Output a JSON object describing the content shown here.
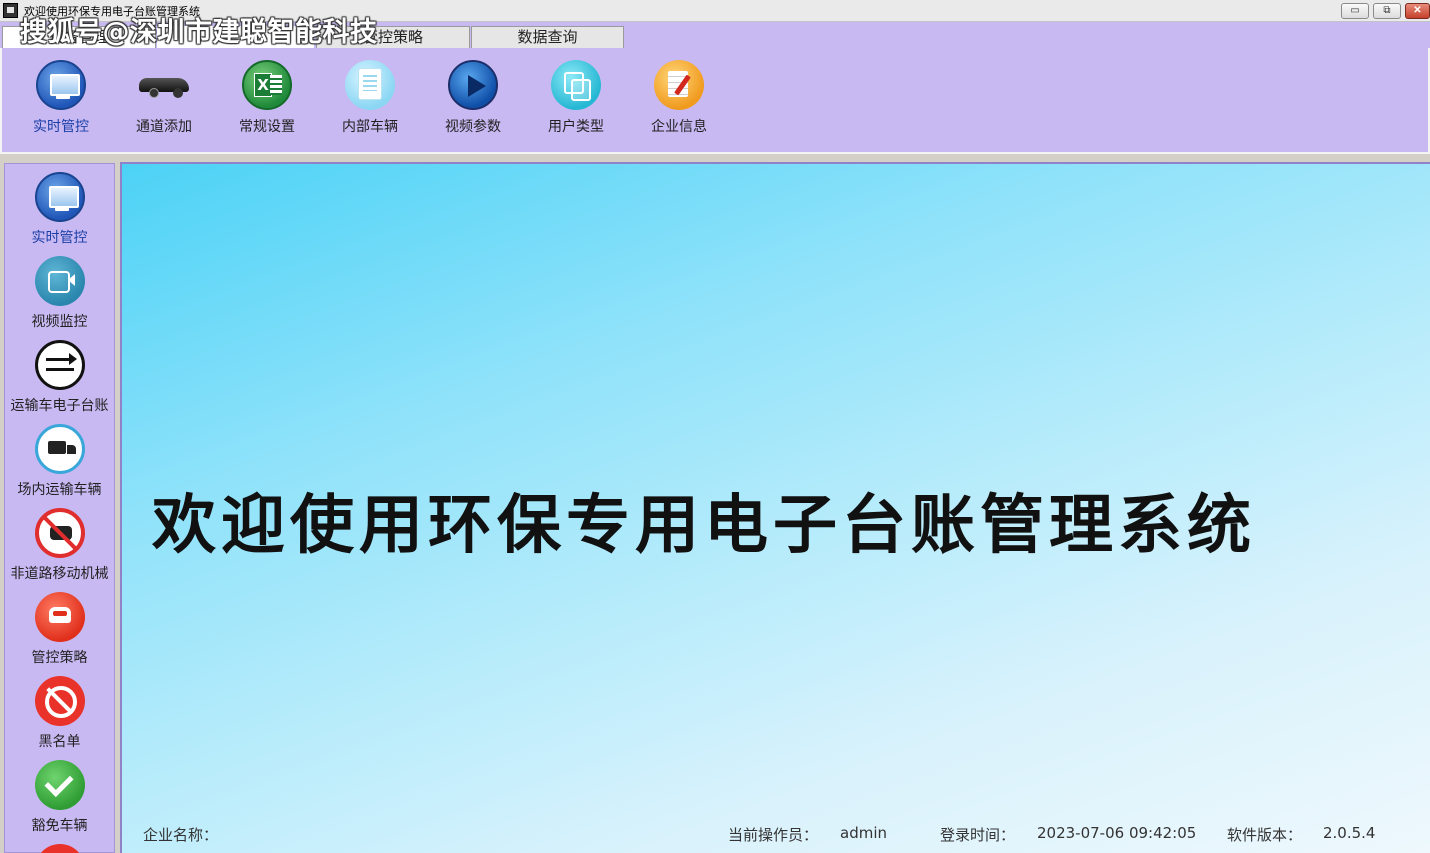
{
  "window": {
    "title": "欢迎使用环保专用电子台账管理系统",
    "watermark": "搜狐号@深圳市建聪智能科技",
    "controls": {
      "minimize": "▭",
      "maximize": "⧉",
      "close": "✕"
    }
  },
  "tabs": [
    {
      "label": "设备管理",
      "icon": ""
    },
    {
      "label": "",
      "icon": ""
    },
    {
      "label": "管控策略",
      "icon": ""
    },
    {
      "label": "数据查询",
      "icon": ""
    }
  ],
  "toolbar": {
    "items": [
      {
        "label": "实时管控",
        "icon": "monitor-icon"
      },
      {
        "label": "通道添加",
        "icon": "car-icon"
      },
      {
        "label": "常规设置",
        "icon": "excel-icon"
      },
      {
        "label": "内部车辆",
        "icon": "document-icon"
      },
      {
        "label": "视频参数",
        "icon": "play-icon"
      },
      {
        "label": "用户类型",
        "icon": "copy-icon"
      },
      {
        "label": "企业信息",
        "icon": "edit-icon"
      }
    ]
  },
  "sidebar": {
    "items": [
      {
        "label": "实时管控",
        "icon": "monitor-icon"
      },
      {
        "label": "视频监控",
        "icon": "video-camera-icon"
      },
      {
        "label": "运输车电子台账",
        "icon": "swap-arrows-icon"
      },
      {
        "label": "场内运输车辆",
        "icon": "truck-icon"
      },
      {
        "label": "非道路移动机械",
        "icon": "no-vehicle-icon"
      },
      {
        "label": "管控策略",
        "icon": "red-car-icon"
      },
      {
        "label": "黑名单",
        "icon": "ban-icon"
      },
      {
        "label": "豁免车辆",
        "icon": "check-icon"
      }
    ]
  },
  "main": {
    "welcome": "欢迎使用环保专用电子台账管理系统",
    "status": {
      "company_label": "企业名称：",
      "company_value": "",
      "operator_label": "当前操作员：",
      "operator_value": "admin",
      "login_label": "登录时间：",
      "login_value": "2023-07-06 09:42:05",
      "version_label": "软件版本：",
      "version_value": "2.0.5.4"
    }
  },
  "colors": {
    "nav_background": "#c9b9f3",
    "active_label": "#1a3ea6",
    "main_gradient_start": "#4cd2f6",
    "main_gradient_end": "#eef8fd"
  }
}
